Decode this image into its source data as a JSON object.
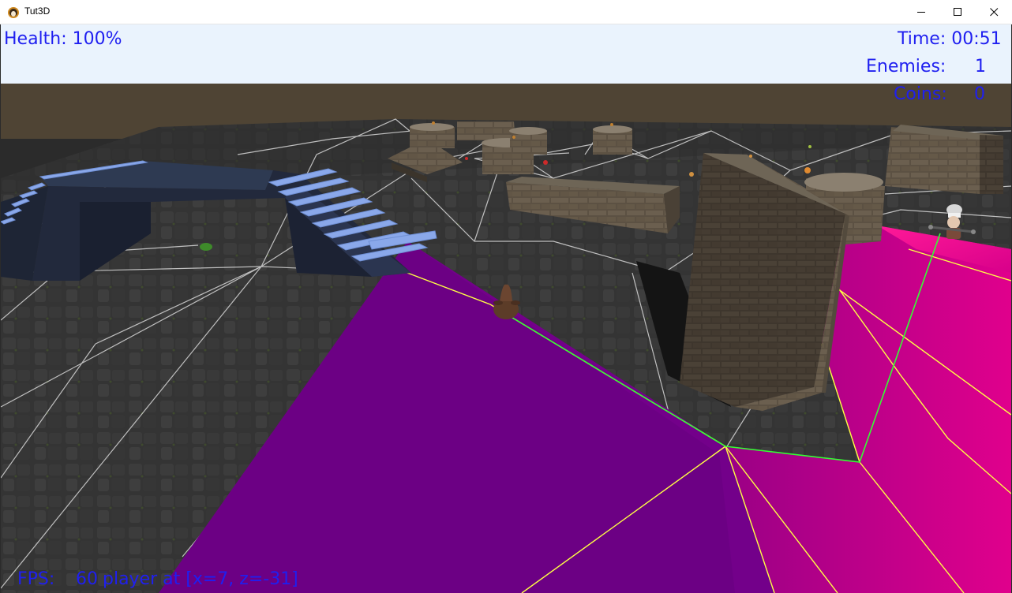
{
  "window": {
    "title": "Tut3D",
    "icon": "penguin-app-icon"
  },
  "hud": {
    "health": "Health: 100%",
    "time": "Time: 00:51",
    "enemies_label": "Enemies:",
    "enemies_value": "1",
    "coins_label": "Coins:",
    "coins_value": "0"
  },
  "footer": {
    "fps_label": "FPS:",
    "fps_value": "60",
    "player_position": "player at [x=7, z=-31]"
  },
  "colors": {
    "hud_text": "#1f1ff0",
    "hud_background": "#eaf3fd",
    "sky": "#4f4434",
    "navmesh_purple": "#6c0084",
    "navmesh_magenta": "#e0008c",
    "path_green": "#33ff33",
    "path_yellow": "#ffff44",
    "stairs_blue": "#8aa8ea"
  }
}
